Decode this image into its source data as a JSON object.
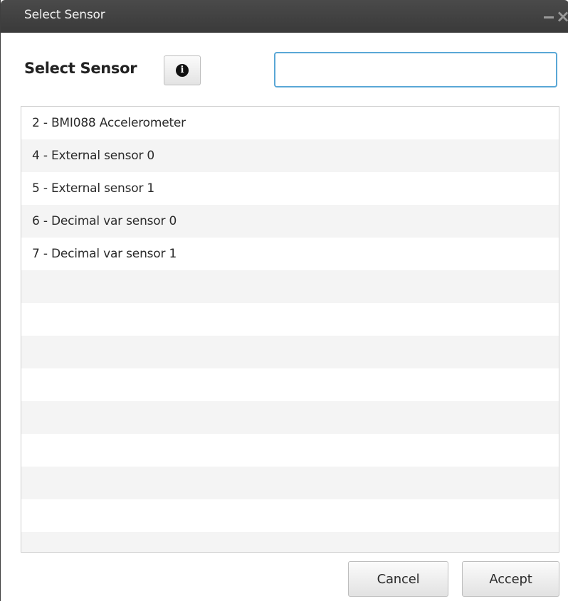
{
  "window": {
    "title": "Select Sensor",
    "minimize_icon": "minimize-icon",
    "close_icon": "close-icon",
    "close_glyph": "×"
  },
  "header": {
    "heading": "Select Sensor",
    "info_icon": "info-icon",
    "info_glyph": "i"
  },
  "search": {
    "value": "",
    "placeholder": ""
  },
  "sensor_list": {
    "items": [
      {
        "label": "2 - BMI088 Accelerometer"
      },
      {
        "label": "4 - External sensor 0"
      },
      {
        "label": "5 - External sensor 1"
      },
      {
        "label": "6 - Decimal var sensor 0"
      },
      {
        "label": "7 - Decimal var sensor 1"
      }
    ]
  },
  "footer": {
    "cancel_label": "Cancel",
    "accept_label": "Accept"
  },
  "colors": {
    "titlebar": "#3a3a3a",
    "input_focus_border": "#5aa7d6",
    "row_alt": "#f4f4f4"
  }
}
